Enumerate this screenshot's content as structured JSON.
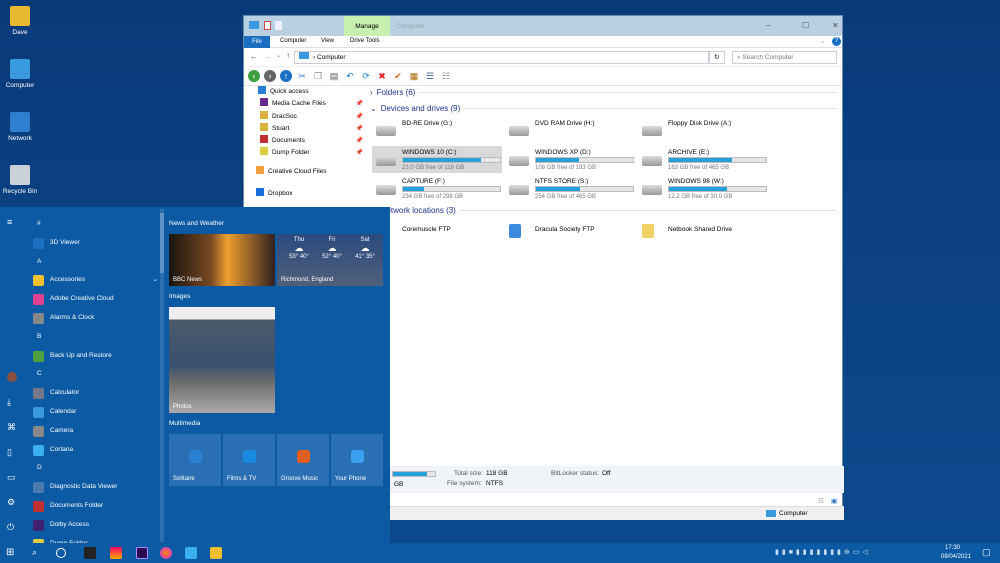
{
  "desktop": {
    "icons": [
      {
        "label": "Dave",
        "color": "#e8b830"
      },
      {
        "label": "Computer",
        "color": "#3a9ae0"
      },
      {
        "label": "Network",
        "color": "#2f7fd0"
      },
      {
        "label": "Recycle Bin",
        "color": "#c8d0d8"
      }
    ]
  },
  "explorer": {
    "manage_tab": "Manage",
    "window_title": "Computer",
    "ribbon_tabs": [
      "File",
      "Computer",
      "View",
      "Drive Tools"
    ],
    "address": "Computer",
    "search_placeholder": "Search Computer",
    "nav": [
      {
        "label": "Quick access",
        "icon": "star-icon",
        "color": "#2a7fd4",
        "pinned": false
      },
      {
        "label": "Media Cache Files",
        "icon": "premiere-icon",
        "color": "#6a2a8a",
        "pinned": true
      },
      {
        "label": "DracSoc",
        "icon": "folder-icon",
        "color": "#d8b040",
        "pinned": true
      },
      {
        "label": "Stuart",
        "icon": "folder-icon",
        "color": "#d8b040",
        "pinned": true
      },
      {
        "label": "Documents",
        "icon": "documents-icon",
        "color": "#c03030",
        "pinned": true
      },
      {
        "label": "Dump Folder",
        "icon": "folder-icon",
        "color": "#e0d040",
        "pinned": true
      },
      {
        "label": "Creative Cloud Files",
        "icon": "creative-cloud-icon",
        "color": "#f0a040",
        "pinned": false
      },
      {
        "label": "Dropbox",
        "icon": "dropbox-icon",
        "color": "#1a6fe0",
        "pinned": false
      }
    ],
    "groups": {
      "folders": "Folders (6)",
      "devices": "Devices and drives (9)",
      "network": "Network locations (3)"
    },
    "devices": [
      {
        "name": "BD-RE Drive (G:)"
      },
      {
        "name": "DVD RAM Drive (H:)"
      },
      {
        "name": "Floppy Disk Drive (A:)"
      }
    ],
    "drives": [
      {
        "name": "WINDOWS 10 (C:)",
        "free": "23.0 GB free of 118 GB",
        "used_fraction": 0.805,
        "selected": true
      },
      {
        "name": "WINDOWS XP (D:)",
        "free": "108 GB free of 193 GB",
        "used_fraction": 0.44
      },
      {
        "name": "ARCHIVE (E:)",
        "free": "163 GB free of 465 GB",
        "used_fraction": 0.65
      },
      {
        "name": "CAPTURE (F:)",
        "free": "234 GB free of 298 GB",
        "used_fraction": 0.215
      },
      {
        "name": "NTFS STORE (S:)",
        "free": "254 GB free of 465 GB",
        "used_fraction": 0.454
      },
      {
        "name": "WINDOWS 98 (W:)",
        "free": "12.2 GB free of 30.0 GB",
        "used_fraction": 0.593
      }
    ],
    "network": [
      {
        "name": "Coremuscle FTP"
      },
      {
        "name": "Dracula Society FTP"
      },
      {
        "name": "Netbook Shared Drive"
      }
    ],
    "details": {
      "free_tail": "GB",
      "total_label": "Total size:",
      "total": "118 GB",
      "fs_label": "File system:",
      "fs": "NTFS",
      "bitlocker_label": "BitLocker status:",
      "bitlocker": "Off"
    },
    "status_location": "Computer"
  },
  "start": {
    "apps": [
      {
        "h": "#"
      },
      {
        "label": "3D Viewer",
        "color": "#1a6fc0"
      },
      {
        "h": "A"
      },
      {
        "label": "Accessories",
        "color": "#f0c030",
        "expand": true
      },
      {
        "label": "Adobe Creative Cloud",
        "color": "#e04090"
      },
      {
        "label": "Alarms & Clock",
        "color": "#888"
      },
      {
        "h": "B"
      },
      {
        "label": "Back Up and Restore",
        "color": "#50a040"
      },
      {
        "h": "C"
      },
      {
        "label": "Calculator",
        "color": "#778"
      },
      {
        "label": "Calendar",
        "color": "#3a9ae0"
      },
      {
        "label": "Camera",
        "color": "#888"
      },
      {
        "label": "Cortana",
        "color": "#3ab0f0"
      },
      {
        "h": "D"
      },
      {
        "label": "Diagnostic Data Viewer",
        "color": "#4a7ab0"
      },
      {
        "label": "Documents Folder",
        "color": "#c03030"
      },
      {
        "label": "Dolby Access",
        "color": "#402070"
      },
      {
        "label": "Dump Folder",
        "color": "#e0d040"
      }
    ],
    "sections": {
      "news": "News and Weather",
      "images": "Images",
      "multimedia": "Multimedia"
    },
    "news_label": "BBC News",
    "weather": {
      "location": "Richmond, England",
      "days": [
        {
          "day": "Thu",
          "temp": "53° 40°"
        },
        {
          "day": "Fri",
          "temp": "52° 40°"
        },
        {
          "day": "Sat",
          "temp": "41° 35°"
        }
      ]
    },
    "photos_label": "Photos",
    "media_tiles": [
      {
        "label": "Solitaire",
        "color": "#2a80d0"
      },
      {
        "label": "Films & TV",
        "color": "#1a8ae0"
      },
      {
        "label": "Groove Music",
        "color": "#e06020"
      },
      {
        "label": "Your Phone",
        "color": "#3aa0f0"
      }
    ]
  },
  "taskbar": {
    "time": "17:30",
    "date": "08/04/2021"
  }
}
